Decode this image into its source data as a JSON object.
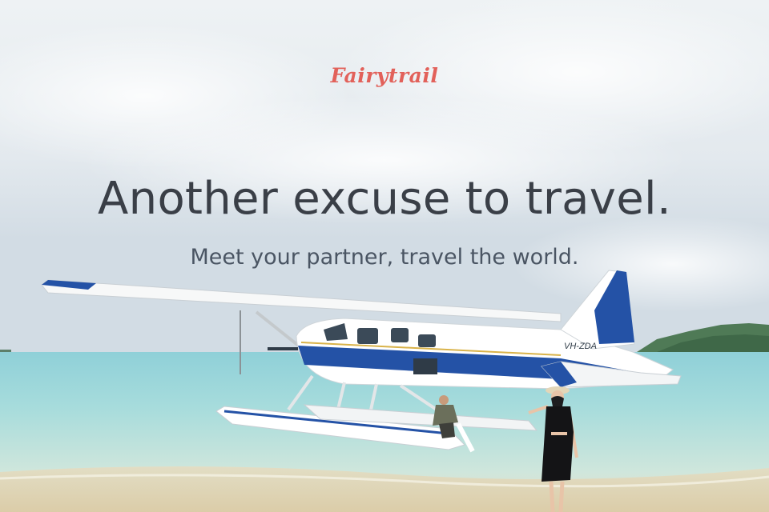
{
  "brand": {
    "logo_text": "Fairytrail",
    "logo_color": "#e2615a"
  },
  "hero": {
    "headline": "Another excuse to travel.",
    "subheadline": "Meet your partner, travel the world.",
    "text_color": "#3a3f47"
  },
  "photo": {
    "plane_registration": "VH-ZDA",
    "accent_color": "#2452a6"
  }
}
